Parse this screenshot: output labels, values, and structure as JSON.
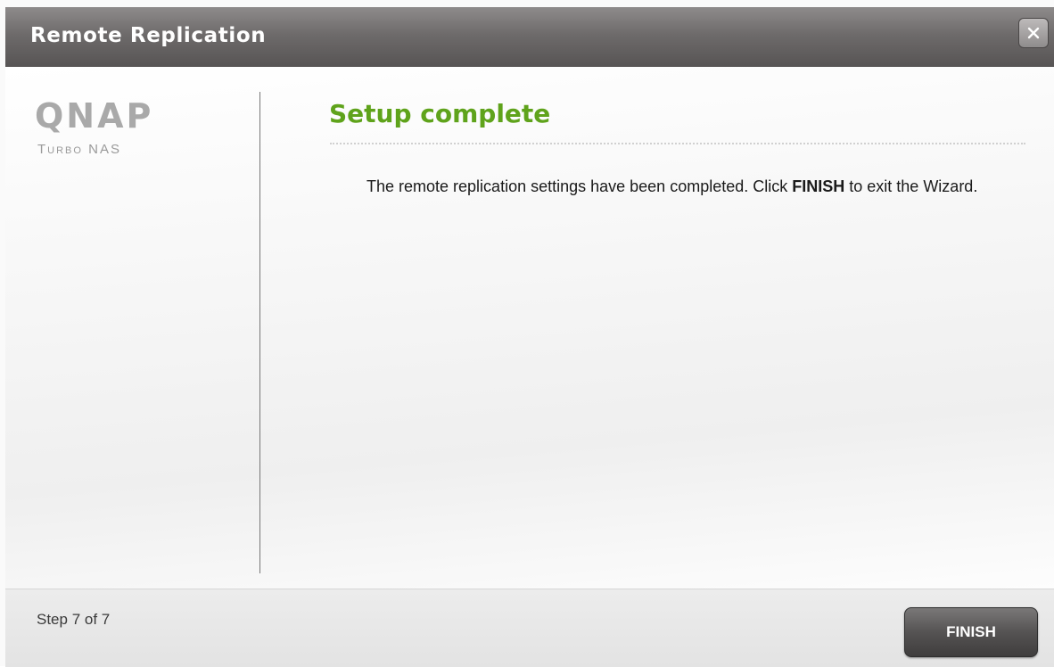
{
  "window": {
    "title": "Remote Replication",
    "close_icon": "close-icon"
  },
  "logo": {
    "brand": "QNAP",
    "subtitle": "Turbo NAS"
  },
  "content": {
    "heading": "Setup complete",
    "message_prefix": "The remote replication settings have been completed. Click ",
    "message_emphasis": "FINISH",
    "message_suffix": " to exit the Wizard."
  },
  "footer": {
    "step": "Step 7 of 7",
    "finish_label": "FINISH"
  },
  "colors": {
    "heading": "#5fa31b",
    "titlebar": "#6e6b6b",
    "button": "#4a4848"
  }
}
